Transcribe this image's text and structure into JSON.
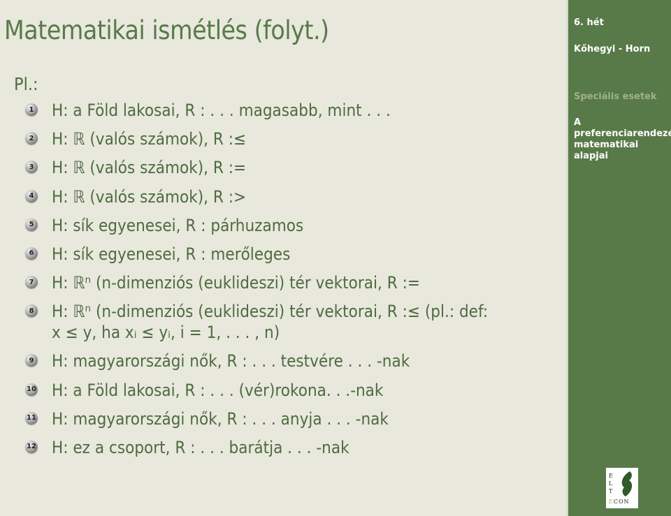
{
  "slide": {
    "title": "Matematikai ismétlés (folyt.)",
    "intro": "Pl.:",
    "items": [
      {
        "num": "1",
        "text": "H: a Föld lakosai, R : . . . magasabb, mint . . ."
      },
      {
        "num": "2",
        "text": "H: ℝ (valós számok), R :≤"
      },
      {
        "num": "3",
        "text": "H: ℝ (valós számok), R :="
      },
      {
        "num": "4",
        "text": "H: ℝ (valós számok), R :>"
      },
      {
        "num": "5",
        "text": "H: sík egyenesei, R : párhuzamos"
      },
      {
        "num": "6",
        "text": "H: sík egyenesei, R : merőleges"
      },
      {
        "num": "7",
        "text": "H: ℝⁿ (n-dimenziós (euklideszi) tér vektorai, R :="
      },
      {
        "num": "8",
        "text": "H: ℝⁿ (n-dimenziós (euklideszi) tér vektorai, R :≤ (pl.: def:",
        "cont": "x ≤ y, ha xᵢ ≤ yᵢ, i = 1, . . . , n)"
      },
      {
        "num": "9",
        "text": "H: magyarországi nők, R : . . . testvére . . . -nak"
      },
      {
        "num": "10",
        "text": "H: a Föld lakosai, R : . . . (vér)rokona. . .-nak"
      },
      {
        "num": "11",
        "text": "H: magyarországi nők, R : . . . anyja . . . -nak"
      },
      {
        "num": "12",
        "text": "H: ez a csoport, R : . . . barátja . . . -nak"
      }
    ]
  },
  "sidebar": {
    "week": "6. hét",
    "authors": "Kőhegyi - Horn",
    "section": "Speciális esetek",
    "subsection": "A preferenciarendezés matematikai alapjai",
    "logo": {
      "letters": [
        "E",
        "L",
        "T"
      ],
      "econ_first": "E",
      "econ_rest": "CON"
    }
  },
  "colors": {
    "background": "#e8e8dd",
    "sidebar": "#587a48",
    "text": "#4f6b3f",
    "section_dim": "#9fb08f"
  }
}
